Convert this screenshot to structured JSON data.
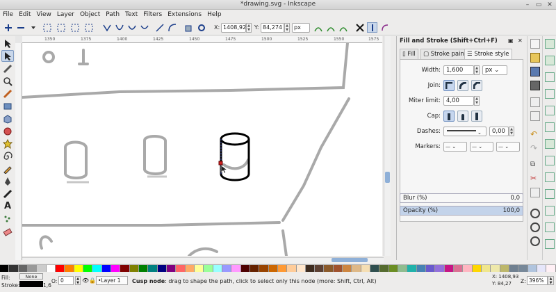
{
  "window": {
    "title": "*drawing.svg - Inkscape"
  },
  "menu": [
    "File",
    "Edit",
    "View",
    "Layer",
    "Object",
    "Path",
    "Text",
    "Filters",
    "Extensions",
    "Help"
  ],
  "toolbar": {
    "x_label": "X:",
    "x_value": "1408,92",
    "y_label": "Y:",
    "y_value": "84,274",
    "unit": "px"
  },
  "ruler": {
    "ticks": [
      "1350",
      "1375",
      "1400",
      "1425",
      "1450",
      "1475",
      "1500",
      "1525",
      "1550",
      "1575"
    ]
  },
  "dialog": {
    "title": "Fill and Stroke (Shift+Ctrl+F)",
    "tabs": [
      "Fill",
      "Stroke paint",
      "Stroke style"
    ],
    "width_label": "Width:",
    "width_value": "1,600",
    "width_unit": "px",
    "join_label": "Join:",
    "miter_label": "Miter limit:",
    "miter_value": "4,00",
    "cap_label": "Cap:",
    "dashes_label": "Dashes:",
    "dash_offset": "0,00",
    "markers_label": "Markers:",
    "blur_label": "Blur (%)",
    "blur_value": "0,0",
    "opacity_label": "Opacity (%)",
    "opacity_value": "100,0",
    "opacity_level": 1.0,
    "blur_level": 0.0
  },
  "status": {
    "fill_label": "Fill:",
    "fill_value": "None",
    "stroke_label": "Stroke:",
    "stroke_width": "1,6",
    "o_label": "O:",
    "o_value": "0",
    "layer": "•Layer 1",
    "message_bold": "Cusp node",
    "message": ": drag to shape the path, click to select only this node (more: Shift, Ctrl, Alt)",
    "coords_x": "X: 1408,93",
    "coords_y": "Y: 84,27",
    "zoom_label": "Z:",
    "zoom_value": "396%"
  },
  "palette": [
    "#000000",
    "#333333",
    "#666666",
    "#999999",
    "#cccccc",
    "#ffffff",
    "#ff0000",
    "#ff8000",
    "#ffff00",
    "#00ff00",
    "#00ffff",
    "#0000ff",
    "#ff00ff",
    "#800000",
    "#808000",
    "#008000",
    "#008080",
    "#000080",
    "#800080",
    "#ff6666",
    "#ffaa66",
    "#ffff99",
    "#99ff99",
    "#99ffff",
    "#9999ff",
    "#ff99ff",
    "#4d0000",
    "#662200",
    "#994400",
    "#cc6600",
    "#ff9933",
    "#ffcc99",
    "#ffe6cc",
    "#3d2b1f",
    "#5c4033",
    "#8b5a2b",
    "#a0522d",
    "#cd853f",
    "#deb887",
    "#f5deb3",
    "#2f4f4f",
    "#556b2f",
    "#6b8e23",
    "#8fbc8f",
    "#20b2aa",
    "#4682b4",
    "#6a5acd",
    "#9370db",
    "#c71585",
    "#db7093",
    "#ffb6c1",
    "#ffd700",
    "#f0e68c",
    "#eee8aa",
    "#bdb76b",
    "#708090",
    "#778899",
    "#b0c4de",
    "#e6e6fa",
    "#fff0f5"
  ],
  "colors": {
    "accent": "#7e9ac2",
    "selection": "#c9d7ea"
  }
}
